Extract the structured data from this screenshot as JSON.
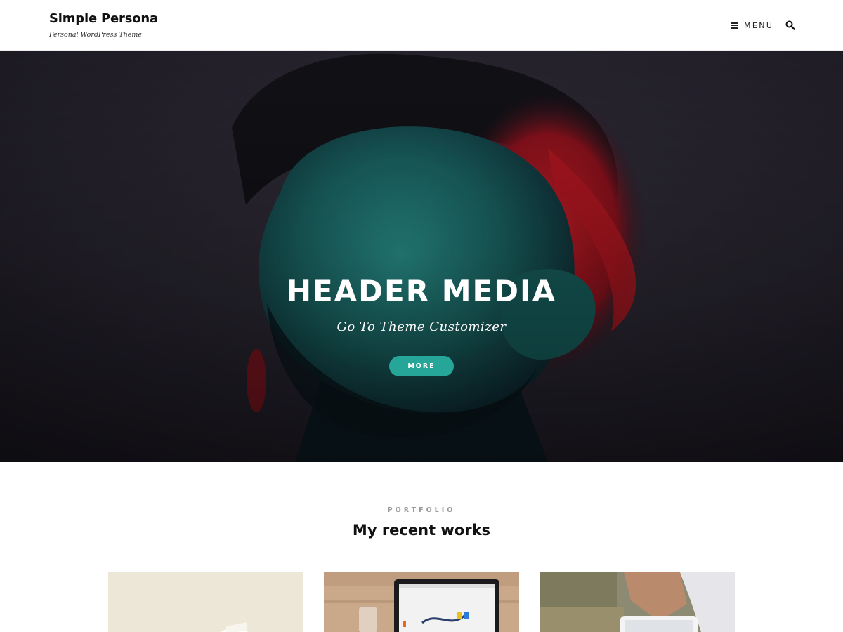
{
  "site": {
    "title": "Simple Persona",
    "tagline": "Personal WordPress Theme"
  },
  "nav": {
    "menu_label": "MENU",
    "menu_icon": "hamburger-icon",
    "search_icon": "search-icon"
  },
  "hero": {
    "title": "HEADER MEDIA",
    "subtitle": "Go To Theme Customizer",
    "button_label": "MORE",
    "accent_color": "#26a699"
  },
  "portfolio": {
    "label": "PORTFOLIO",
    "title": "My recent works",
    "items": [
      {
        "image": "paper-on-desk"
      },
      {
        "image": "laptop-on-wood-desk"
      },
      {
        "image": "hands-with-tablet"
      }
    ]
  }
}
